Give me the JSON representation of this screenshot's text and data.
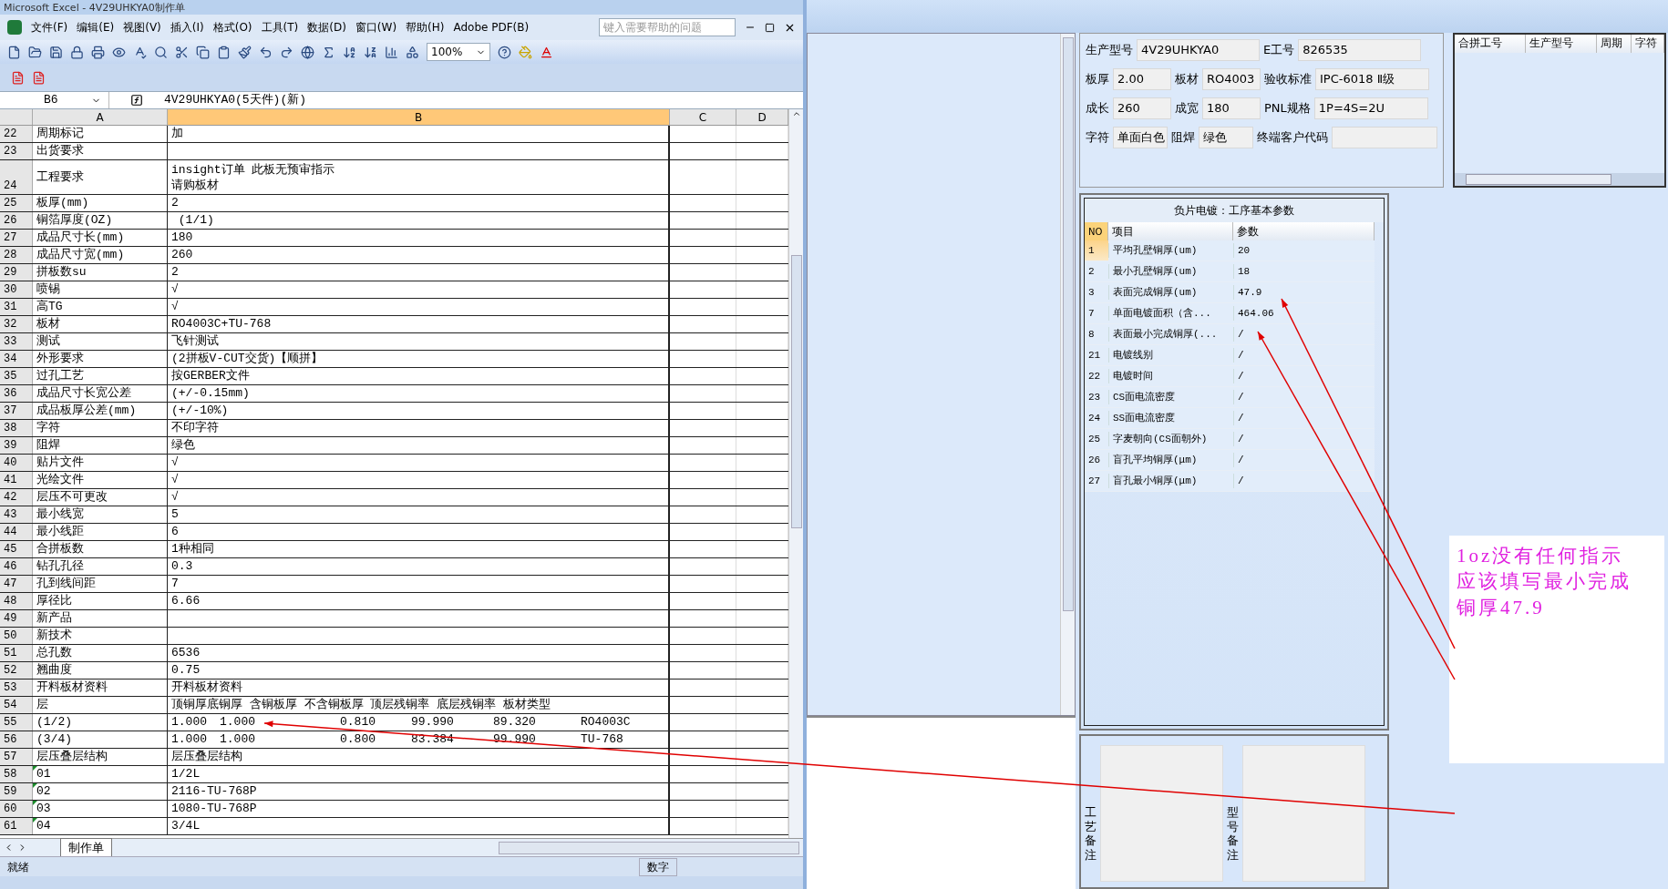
{
  "excel": {
    "title": "Microsoft Excel - 4V29UHKYA0制作单",
    "menu": [
      "文件(F)",
      "编辑(E)",
      "视图(V)",
      "插入(I)",
      "格式(O)",
      "工具(T)",
      "数据(D)",
      "窗口(W)",
      "帮助(H)",
      "Adobe PDF(B)"
    ],
    "help_box": {
      "placeholder": "键入需要帮助的问题"
    },
    "zoom": "100%",
    "name_box": "B6",
    "formula": "4V29UHKYA0(5天件)(新)",
    "columns": [
      {
        "label": "A",
        "selected": false
      },
      {
        "label": "B",
        "selected": true
      },
      {
        "label": "C",
        "selected": false
      },
      {
        "label": "D",
        "selected": false
      }
    ],
    "rows": [
      {
        "num": "22",
        "a": "周期标记",
        "b": "加"
      },
      {
        "num": "23",
        "a": "出货要求",
        "b": ""
      },
      {
        "num": "24",
        "a": "工程要求",
        "b_lines": [
          "insight订单  此板无预审指示",
          "请购板材"
        ]
      },
      {
        "num": "25",
        "a": "板厚(mm)",
        "b": "2"
      },
      {
        "num": "26",
        "a": "铜箔厚度(OZ)",
        "b": " (1/1)"
      },
      {
        "num": "27",
        "a": "成品尺寸长(mm)",
        "b": "180"
      },
      {
        "num": "28",
        "a": "成品尺寸宽(mm)",
        "b": "260"
      },
      {
        "num": "29",
        "a": "拼板数su",
        "b": "2"
      },
      {
        "num": "30",
        "a": "喷锡",
        "b": "√"
      },
      {
        "num": "31",
        "a": "高TG",
        "b": "√"
      },
      {
        "num": "32",
        "a": "板材",
        "b": "RO4003C+TU-768"
      },
      {
        "num": "33",
        "a": "测试",
        "b": "飞针测试"
      },
      {
        "num": "34",
        "a": "外形要求",
        "b": "(2拼板V-CUT交货)【顺拼】"
      },
      {
        "num": "35",
        "a": "过孔工艺",
        "b": "按GERBER文件"
      },
      {
        "num": "36",
        "a": "成品尺寸长宽公差",
        "b": "(+/-0.15mm)"
      },
      {
        "num": "37",
        "a": "成品板厚公差(mm)",
        "b": "(+/-10%)"
      },
      {
        "num": "38",
        "a": "字符",
        "b": "不印字符"
      },
      {
        "num": "39",
        "a": "阻焊",
        "b": "绿色"
      },
      {
        "num": "40",
        "a": "贴片文件",
        "b": "√"
      },
      {
        "num": "41",
        "a": "光绘文件",
        "b": "√"
      },
      {
        "num": "42",
        "a": "层压不可更改",
        "b": "√"
      },
      {
        "num": "43",
        "a": "最小线宽",
        "b": "5"
      },
      {
        "num": "44",
        "a": "最小线距",
        "b": "6"
      },
      {
        "num": "45",
        "a": "合拼板数",
        "b": "1种相同"
      },
      {
        "num": "46",
        "a": "钻孔孔径",
        "b": "0.3"
      },
      {
        "num": "47",
        "a": "孔到线间距",
        "b": "7"
      },
      {
        "num": "48",
        "a": "厚径比",
        "b": "6.66"
      },
      {
        "num": "49",
        "a": "新产品",
        "b": ""
      },
      {
        "num": "50",
        "a": "新技术",
        "b": ""
      },
      {
        "num": "51",
        "a": "总孔数",
        "b": "6536"
      },
      {
        "num": "52",
        "a": "翘曲度",
        "b": "0.75"
      },
      {
        "num": "53",
        "a": "开料板材资料",
        "b": "开料板材资料"
      },
      {
        "num": "54",
        "a": "层",
        "b": "顶铜厚底铜厚 含铜板厚 不含铜板厚 顶层残铜率 底层残铜率 板材类型"
      },
      {
        "num": "55",
        "a": "(1/2)",
        "b_parts": [
          "1.000",
          "1.000",
          "0.810",
          "99.990",
          "89.320",
          "RO4003C"
        ]
      },
      {
        "num": "56",
        "a": "(3/4)",
        "b_parts": [
          "1.000",
          "1.000",
          "0.800",
          "83.384",
          "99.990",
          "TU-768"
        ]
      },
      {
        "num": "57",
        "a": "层压叠层结构",
        "b": "层压叠层结构"
      },
      {
        "num": "58",
        "a": "01",
        "b": "1/2L",
        "flag": true
      },
      {
        "num": "59",
        "a": "02",
        "b": "2116-TU-768P",
        "flag": true
      },
      {
        "num": "60",
        "a": "03",
        "b": "1080-TU-768P",
        "flag": true
      },
      {
        "num": "61",
        "a": "04",
        "b": "3/4L",
        "flag": true
      }
    ],
    "sheet_tab": "制作单",
    "status": "就绪",
    "status_mode": "数字"
  },
  "form": {
    "fields": [
      [
        {
          "label": "生产型号",
          "value": "4V29UHKYA0"
        },
        {
          "label": "E工号",
          "value": "826535"
        }
      ],
      [
        {
          "label": "板厚",
          "value": "2.00"
        },
        {
          "label": "板材",
          "value": "RO4003"
        },
        {
          "label": "验收标准",
          "value": "IPC-6018 Ⅱ级"
        }
      ],
      [
        {
          "label": "成长",
          "value": "260"
        },
        {
          "label": "成宽",
          "value": "180"
        },
        {
          "label": "PNL规格",
          "value": "1P=4S=2U"
        }
      ],
      [
        {
          "label": "字符",
          "value": "单面白色"
        },
        {
          "label": "阻焊",
          "value": "绿色"
        },
        {
          "label": "终端客户代码"
        }
      ]
    ]
  },
  "merge_grid": {
    "columns": [
      "合拼工号",
      "生产型号",
      "周期",
      "字符"
    ]
  },
  "params": {
    "title": "负片电镀：工序基本参数",
    "columns": [
      "NO",
      "项目",
      "参数"
    ],
    "rows": [
      {
        "no": "1",
        "item": "平均孔壁铜厚(um)",
        "value": "20",
        "selected": true
      },
      {
        "no": "2",
        "item": "最小孔壁铜厚(um)",
        "value": "18",
        "selected": false
      },
      {
        "no": "3",
        "item": "表面完成铜厚(um)",
        "value": "47.9",
        "selected": false
      },
      {
        "no": "7",
        "item": "单面电镀面积（含...",
        "value": "464.06",
        "selected": false
      },
      {
        "no": "8",
        "item": "表面最小完成铜厚(...",
        "value": "/",
        "selected": false
      },
      {
        "no": "21",
        "item": "电镀线别",
        "value": "/",
        "selected": false
      },
      {
        "no": "22",
        "item": "电镀时间",
        "value": "/",
        "selected": false
      },
      {
        "no": "23",
        "item": "CS面电流密度",
        "value": "/",
        "selected": false
      },
      {
        "no": "24",
        "item": "SS面电流密度",
        "value": "/",
        "selected": false
      },
      {
        "no": "25",
        "item": "字麦朝向(CS面朝外)",
        "value": "/",
        "selected": false
      },
      {
        "no": "26",
        "item": "盲孔平均铜厚(μm)",
        "value": "/",
        "selected": false
      },
      {
        "no": "27",
        "item": "盲孔最小铜厚(μm)",
        "value": "/",
        "selected": false
      }
    ]
  },
  "remarks": [
    {
      "label": "工艺备注"
    },
    {
      "label": "型号备注"
    }
  ],
  "annotation": {
    "lines": [
      "1oz没有任何指示",
      "应该填写最小完成",
      "铜厚47.9"
    ]
  }
}
